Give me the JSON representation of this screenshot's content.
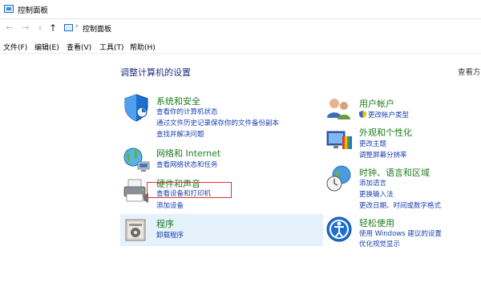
{
  "window": {
    "title": "控制面板"
  },
  "address": {
    "back": "←",
    "forward": "→",
    "dropdown": "∨",
    "up": "↑",
    "sep": "›",
    "crumb": "控制面板"
  },
  "menu": [
    "文件(F)",
    "编辑(E)",
    "查看(V)",
    "工具(T)",
    "帮助(H)"
  ],
  "main": {
    "heading": "调整计算机的设置",
    "view_by": "查看方"
  },
  "categories": {
    "security": {
      "title": "系统和安全",
      "links": [
        "查看你的计算机状态",
        "通过文件历史记录保存你的文件备份副本",
        "查找并解决问题"
      ]
    },
    "network": {
      "title": "网络和 Internet",
      "links": [
        "查看网络状态和任务"
      ]
    },
    "hardware": {
      "title": "硬件和声音",
      "links": [
        "查看设备和打印机",
        "添加设备"
      ]
    },
    "programs": {
      "title": "程序",
      "links": [
        "卸载程序"
      ]
    },
    "accounts": {
      "title": "用户帐户",
      "links": [
        "更改帐户类型"
      ]
    },
    "appearance": {
      "title": "外观和个性化",
      "links": [
        "更改主题",
        "调整屏幕分辨率"
      ]
    },
    "clock": {
      "title": "时钟、语言和区域",
      "links": [
        "添加语言",
        "更换输入法",
        "更改日期、时间或数字格式"
      ]
    },
    "ease": {
      "title": "轻松使用",
      "links": [
        "使用 Windows 建议的设置",
        "优化视觉显示"
      ]
    }
  },
  "colors": {
    "link": "#1a3fb0",
    "category_title": "#1e7c1e",
    "heading": "#1e3287",
    "selection": "#e5f1fb",
    "highlight_box": "#e03030"
  }
}
